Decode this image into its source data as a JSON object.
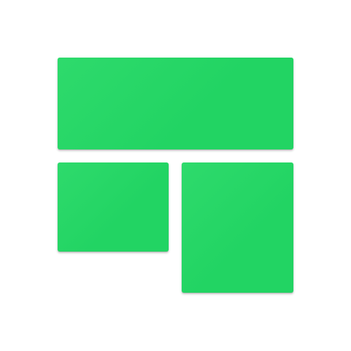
{
  "logo": {
    "name": "tiled-layout-logo",
    "tile_color": "#22D463",
    "tile_highlight": "#2EDA6C",
    "background": "#FFFFFF"
  }
}
